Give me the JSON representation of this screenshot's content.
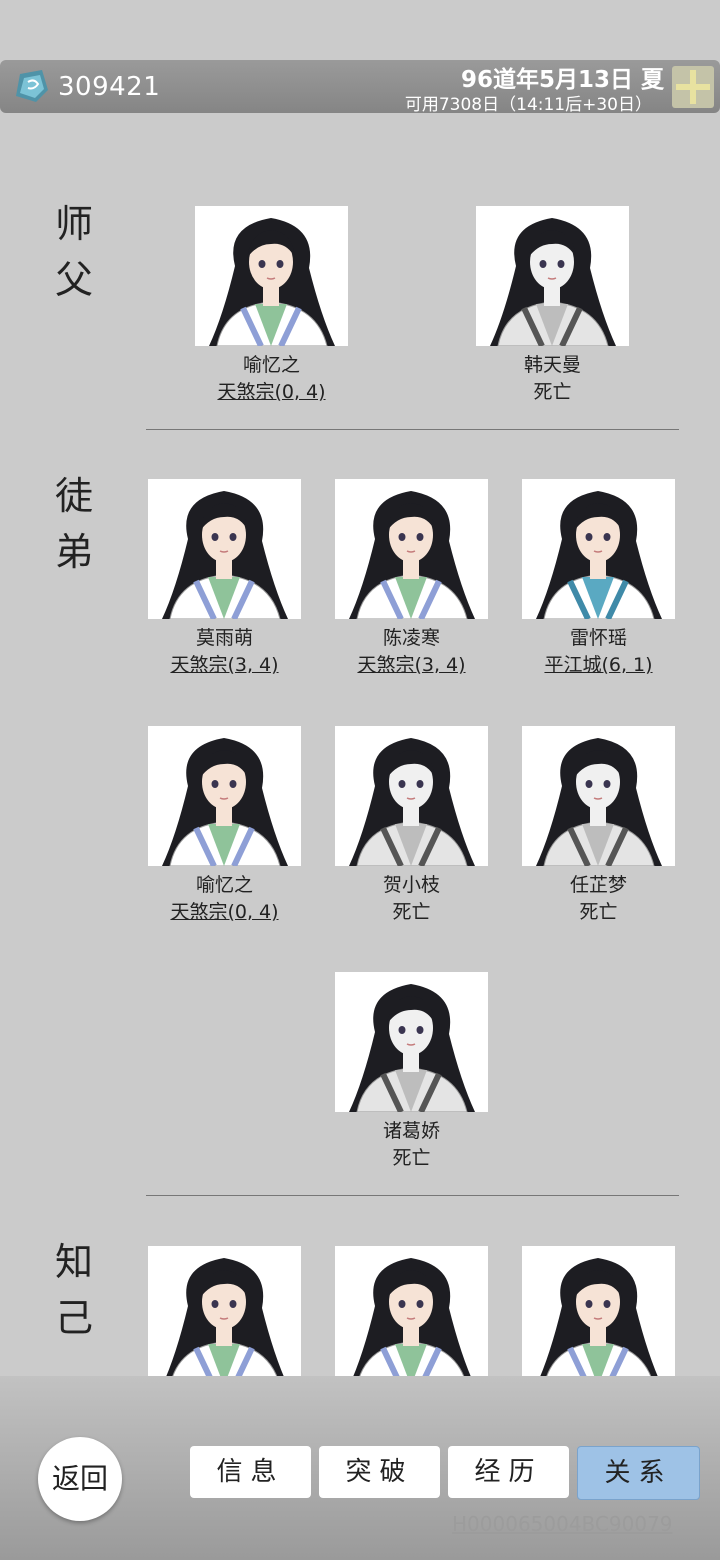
{
  "header": {
    "currency_amount": "309421",
    "date": "96道年5月13日 夏",
    "available": "可用7308日（14:11后+30日）"
  },
  "sections": {
    "master": "师\n父",
    "disciples": "徒\n弟",
    "confidants": "知\n己"
  },
  "master": [
    {
      "name": "喻忆之",
      "status": "天煞宗(0, 4)"
    },
    {
      "name": "韩天曼",
      "status": "死亡"
    }
  ],
  "disciples": [
    {
      "name": "莫雨萌",
      "status": "天煞宗(3, 4)"
    },
    {
      "name": "陈凌寒",
      "status": "天煞宗(3, 4)"
    },
    {
      "name": "雷怀瑶",
      "status": "平江城(6, 1)"
    },
    {
      "name": "喻忆之",
      "status": "天煞宗(0, 4)"
    },
    {
      "name": "贺小枝",
      "status": "死亡"
    },
    {
      "name": "任芷梦",
      "status": "死亡"
    },
    {
      "name": "诸葛娇",
      "status": "死亡"
    }
  ],
  "confidants": [
    {
      "name": "",
      "status": ""
    },
    {
      "name": "",
      "status": ""
    },
    {
      "name": "",
      "status": ""
    }
  ],
  "nav": {
    "back": "返回",
    "tabs": [
      "信息",
      "突破",
      "经历",
      "关系"
    ],
    "active_tab": "关系"
  },
  "footer": {
    "id": "H000065004BC90079"
  },
  "colors": {
    "topbar": "#8e8e8e",
    "active_tab": "#9ec2e6",
    "background": "#cbcbcb"
  }
}
